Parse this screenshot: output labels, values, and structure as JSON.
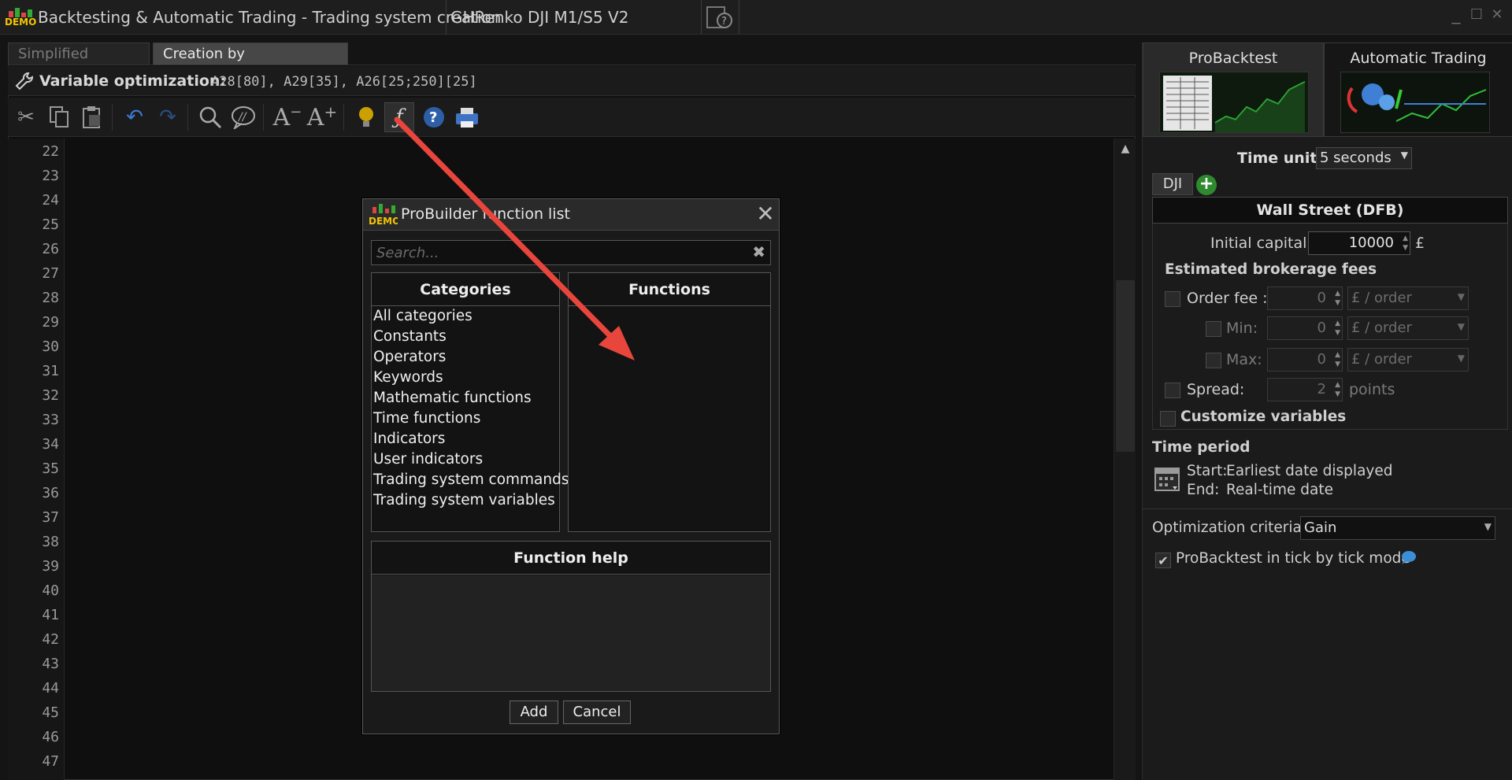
{
  "window": {
    "title": "Backtesting & Automatic Trading - Trading system creation",
    "system_name": "GHRenko DJI M1/S5 V2",
    "logo_text": "DEMO",
    "minimize": "_",
    "maximize": "☐",
    "close": "✕"
  },
  "tabs": [
    {
      "label": "Simplified creation",
      "active": false
    },
    {
      "label": "Creation by programming",
      "active": true
    }
  ],
  "variable_optimization": {
    "label": "Variable optimization:",
    "value": "A28[80], A29[35], A26[25;250][25]"
  },
  "toolbar_icons": [
    "cut-icon",
    "copy-icon",
    "paste-icon",
    "undo-icon",
    "redo-icon",
    "search-icon",
    "comment-icon",
    "font-decrease-icon",
    "font-increase-icon",
    "lightbulb-icon",
    "function-icon",
    "help-icon",
    "print-icon"
  ],
  "line_numbers": [
    "22",
    "23",
    "24",
    "25",
    "26",
    "27",
    "28",
    "29",
    "30",
    "31",
    "32",
    "33",
    "34",
    "35",
    "36",
    "37",
    "38",
    "39",
    "40",
    "41",
    "42",
    "43",
    "44",
    "45",
    "46",
    "47"
  ],
  "right_panel": {
    "tabs": [
      {
        "label": "ProBacktest",
        "active": true
      },
      {
        "label": "Automatic Trading",
        "active": false
      }
    ],
    "time_unit_label": "Time unit:",
    "time_unit_value": "5 seconds",
    "instrument_tab": "DJI",
    "instrument_name": "Wall Street (DFB)",
    "initial_capital_label": "Initial capital :",
    "initial_capital_value": "10000",
    "currency": "£",
    "fees_heading": "Estimated brokerage fees",
    "order_fee_label": "Order fee :",
    "order_fee_value": "0",
    "order_fee_unit": "£ / order",
    "min_label": "Min:",
    "min_value": "0",
    "min_unit": "£ / order",
    "max_label": "Max:",
    "max_value": "0",
    "max_unit": "£ / order",
    "spread_label": "Spread:",
    "spread_value": "2",
    "spread_unit": "points",
    "customize_label": "Customize variables",
    "time_period_heading": "Time period",
    "start_label": "Start:",
    "start_value": "Earliest date displayed",
    "end_label": "End:",
    "end_value": "Real-time date",
    "opt_criteria_label": "Optimization criteria :",
    "opt_criteria_value": "Gain",
    "tick_mode_label": "ProBacktest in tick by tick mode",
    "tick_mode_checked": true
  },
  "modal": {
    "title": "ProBuilder function list",
    "search_placeholder": "Search...",
    "categories_header": "Categories",
    "functions_header": "Functions",
    "help_header": "Function help",
    "categories": [
      "All categories",
      "Constants",
      "Operators",
      "Keywords",
      "Mathematic functions",
      "Time functions",
      "Indicators",
      "User indicators",
      "Trading system commands",
      "Trading system variables"
    ],
    "add_label": "Add",
    "cancel_label": "Cancel"
  },
  "colors": {
    "background": "#141414",
    "annotation_arrow": "#e8463c",
    "logo_yellow": "#f2c400",
    "add_green": "#2e8a2e"
  }
}
